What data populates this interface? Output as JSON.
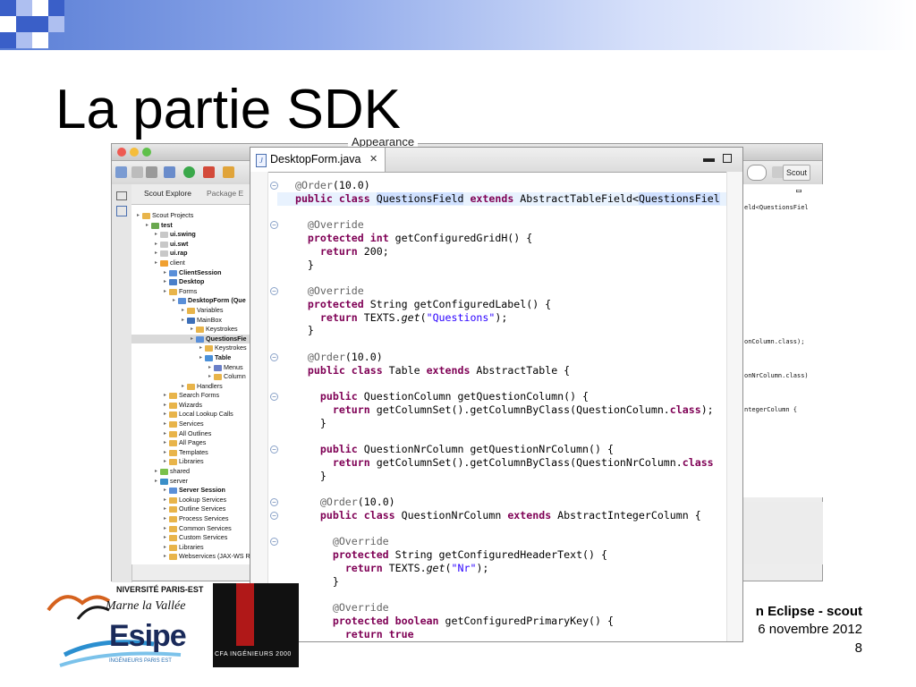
{
  "slide": {
    "title": "La partie SDK",
    "footer_line1": "n Eclipse - scout",
    "footer_line2": "6 novembre 2012",
    "page_number": "8",
    "logo_university": "NIVERSITÉ PARIS-EST",
    "logo_mlv": "Marne la Vallée",
    "logo_esipe": "Esipe",
    "logo_esipe_sub": "INGÉNIEURS PARIS EST",
    "logo_cfa": "CFA INGÉNIEURS 2000"
  },
  "colors": {
    "keyword": "#7f0055",
    "string": "#2a00ff",
    "annotation": "#646464",
    "field": "#0000c0",
    "selection": "#cfe0ff"
  },
  "background_window": {
    "appearance_label": "Appearance",
    "scout_button": "Scout",
    "explorer_tabs": [
      "Scout Explore",
      "Package E"
    ],
    "tree": [
      {
        "label": "Scout Projects",
        "depth": 0,
        "bold": false,
        "icon": "folder"
      },
      {
        "label": "test",
        "depth": 1,
        "bold": true,
        "icon": "project"
      },
      {
        "label": "ui.swing",
        "depth": 2,
        "bold": true,
        "icon": "ui"
      },
      {
        "label": "ui.swt",
        "depth": 2,
        "bold": true,
        "icon": "ui"
      },
      {
        "label": "ui.rap",
        "depth": 2,
        "bold": true,
        "icon": "ui"
      },
      {
        "label": "client",
        "depth": 2,
        "bold": false,
        "icon": "client"
      },
      {
        "label": "ClientSession",
        "depth": 3,
        "bold": true,
        "icon": "session"
      },
      {
        "label": "Desktop",
        "depth": 3,
        "bold": true,
        "icon": "desktop"
      },
      {
        "label": "Forms",
        "depth": 3,
        "bold": false,
        "icon": "folder"
      },
      {
        "label": "DesktopForm (Que",
        "depth": 4,
        "bold": true,
        "icon": "form"
      },
      {
        "label": "Variables",
        "depth": 5,
        "bold": false,
        "icon": "folder"
      },
      {
        "label": "MainBox",
        "depth": 5,
        "bold": false,
        "icon": "box"
      },
      {
        "label": "Keystrokes",
        "depth": 6,
        "bold": false,
        "icon": "folder"
      },
      {
        "label": "QuestionsFie",
        "depth": 6,
        "bold": true,
        "icon": "field",
        "selected": true
      },
      {
        "label": "Keystrokes",
        "depth": 7,
        "bold": false,
        "icon": "folder"
      },
      {
        "label": "Table",
        "depth": 7,
        "bold": true,
        "icon": "table"
      },
      {
        "label": "Menus",
        "depth": 8,
        "bold": false,
        "icon": "menu"
      },
      {
        "label": "Column",
        "depth": 8,
        "bold": false,
        "icon": "folder"
      },
      {
        "label": "Handlers",
        "depth": 5,
        "bold": false,
        "icon": "folder"
      },
      {
        "label": "Search Forms",
        "depth": 3,
        "bold": false,
        "icon": "folder"
      },
      {
        "label": "Wizards",
        "depth": 3,
        "bold": false,
        "icon": "folder"
      },
      {
        "label": "Local Lookup Calls",
        "depth": 3,
        "bold": false,
        "icon": "folder"
      },
      {
        "label": "Services",
        "depth": 3,
        "bold": false,
        "icon": "folder"
      },
      {
        "label": "All Outlines",
        "depth": 3,
        "bold": false,
        "icon": "folder"
      },
      {
        "label": "All Pages",
        "depth": 3,
        "bold": false,
        "icon": "folder"
      },
      {
        "label": "Templates",
        "depth": 3,
        "bold": false,
        "icon": "folder"
      },
      {
        "label": "Libraries",
        "depth": 3,
        "bold": false,
        "icon": "folder"
      },
      {
        "label": "shared",
        "depth": 2,
        "bold": false,
        "icon": "shared"
      },
      {
        "label": "server",
        "depth": 2,
        "bold": false,
        "icon": "server"
      },
      {
        "label": "Server Session",
        "depth": 3,
        "bold": true,
        "icon": "session"
      },
      {
        "label": "Lookup Services",
        "depth": 3,
        "bold": false,
        "icon": "folder"
      },
      {
        "label": "Outline Services",
        "depth": 3,
        "bold": false,
        "icon": "folder"
      },
      {
        "label": "Process Services",
        "depth": 3,
        "bold": false,
        "icon": "folder"
      },
      {
        "label": "Common Services",
        "depth": 3,
        "bold": false,
        "icon": "folder"
      },
      {
        "label": "Custom Services",
        "depth": 3,
        "bold": false,
        "icon": "folder"
      },
      {
        "label": "Libraries",
        "depth": 3,
        "bold": false,
        "icon": "folder"
      },
      {
        "label": "Webservices (JAX-WS R",
        "depth": 3,
        "bold": false,
        "icon": "folder"
      }
    ],
    "right_pane_lines": [
      "eld<QuestionsFiel",
      "onColumn.class);",
      "onNrColumn.class)",
      "ntegerColumn {"
    ]
  },
  "editor": {
    "tab_title": "DesktopForm.java",
    "lines": [
      {
        "indent": 2,
        "parts": [
          [
            "ann",
            "@Order"
          ],
          [
            "",
            "("
          ],
          [
            "",
            "10.0"
          ],
          [
            "",
            ")"
          ]
        ]
      },
      {
        "indent": 2,
        "highlight": true,
        "parts": [
          [
            "kw",
            "public"
          ],
          [
            "",
            " "
          ],
          [
            "kw",
            "class"
          ],
          [
            "",
            " "
          ],
          [
            "sel",
            "QuestionsField"
          ],
          [
            "",
            " "
          ],
          [
            "kw",
            "extends"
          ],
          [
            "",
            " AbstractTableField<"
          ],
          [
            "sel",
            "QuestionsFiel"
          ]
        ]
      },
      {
        "indent": 0,
        "parts": []
      },
      {
        "indent": 4,
        "parts": [
          [
            "ann",
            "@Override"
          ]
        ]
      },
      {
        "indent": 4,
        "parts": [
          [
            "kw",
            "protected"
          ],
          [
            "",
            " "
          ],
          [
            "kw",
            "int"
          ],
          [
            "",
            " getConfiguredGridH() {"
          ]
        ]
      },
      {
        "indent": 6,
        "parts": [
          [
            "kw",
            "return"
          ],
          [
            "",
            " 200;"
          ]
        ]
      },
      {
        "indent": 4,
        "parts": [
          [
            "",
            "}"
          ]
        ]
      },
      {
        "indent": 0,
        "parts": []
      },
      {
        "indent": 4,
        "parts": [
          [
            "ann",
            "@Override"
          ]
        ]
      },
      {
        "indent": 4,
        "parts": [
          [
            "kw",
            "protected"
          ],
          [
            "",
            " String getConfiguredLabel() {"
          ]
        ]
      },
      {
        "indent": 6,
        "parts": [
          [
            "kw",
            "return"
          ],
          [
            "",
            " TEXTS."
          ],
          [
            "it",
            "get"
          ],
          [
            "",
            "("
          ],
          [
            "str",
            "\"Questions\""
          ],
          [
            "",
            ");"
          ]
        ]
      },
      {
        "indent": 4,
        "parts": [
          [
            "",
            "}"
          ]
        ]
      },
      {
        "indent": 0,
        "parts": []
      },
      {
        "indent": 4,
        "parts": [
          [
            "ann",
            "@Order"
          ],
          [
            "",
            "(10.0)"
          ]
        ]
      },
      {
        "indent": 4,
        "parts": [
          [
            "kw",
            "public"
          ],
          [
            "",
            " "
          ],
          [
            "kw",
            "class"
          ],
          [
            "",
            " Table "
          ],
          [
            "kw",
            "extends"
          ],
          [
            "",
            " AbstractTable {"
          ]
        ]
      },
      {
        "indent": 0,
        "parts": []
      },
      {
        "indent": 6,
        "parts": [
          [
            "kw",
            "public"
          ],
          [
            "",
            " QuestionColumn getQuestionColumn() {"
          ]
        ]
      },
      {
        "indent": 8,
        "parts": [
          [
            "kw",
            "return"
          ],
          [
            "",
            " getColumnSet().getColumnByClass(QuestionColumn."
          ],
          [
            "kw",
            "class"
          ],
          [
            "",
            ");"
          ]
        ]
      },
      {
        "indent": 6,
        "parts": [
          [
            "",
            "}"
          ]
        ]
      },
      {
        "indent": 0,
        "parts": []
      },
      {
        "indent": 6,
        "parts": [
          [
            "kw",
            "public"
          ],
          [
            "",
            " QuestionNrColumn getQuestionNrColumn() {"
          ]
        ]
      },
      {
        "indent": 8,
        "parts": [
          [
            "kw",
            "return"
          ],
          [
            "",
            " getColumnSet().getColumnByClass(QuestionNrColumn."
          ],
          [
            "kw",
            "class"
          ],
          [
            ")"
          ]
        ]
      },
      {
        "indent": 6,
        "parts": [
          [
            "",
            "}"
          ]
        ]
      },
      {
        "indent": 0,
        "parts": []
      },
      {
        "indent": 6,
        "parts": [
          [
            "ann",
            "@Order"
          ],
          [
            "",
            "(10.0)"
          ]
        ]
      },
      {
        "indent": 6,
        "parts": [
          [
            "kw",
            "public"
          ],
          [
            "",
            " "
          ],
          [
            "kw",
            "class"
          ],
          [
            "",
            " QuestionNrColumn "
          ],
          [
            "kw",
            "extends"
          ],
          [
            "",
            " AbstractIntegerColumn {"
          ]
        ]
      },
      {
        "indent": 0,
        "parts": []
      },
      {
        "indent": 8,
        "parts": [
          [
            "ann",
            "@Override"
          ]
        ]
      },
      {
        "indent": 8,
        "parts": [
          [
            "kw",
            "protected"
          ],
          [
            "",
            " String getConfiguredHeaderText() {"
          ]
        ]
      },
      {
        "indent": 10,
        "parts": [
          [
            "kw",
            "return"
          ],
          [
            "",
            " TEXTS."
          ],
          [
            "it",
            "get"
          ],
          [
            "",
            "("
          ],
          [
            "str",
            "\"Nr\""
          ],
          [
            "",
            ");"
          ]
        ]
      },
      {
        "indent": 8,
        "parts": [
          [
            "",
            "}"
          ]
        ]
      },
      {
        "indent": 0,
        "parts": []
      },
      {
        "indent": 8,
        "parts": [
          [
            "ann",
            "@Override"
          ]
        ]
      },
      {
        "indent": 8,
        "parts": [
          [
            "kw",
            "protected"
          ],
          [
            "",
            " "
          ],
          [
            "kw",
            "boolean"
          ],
          [
            "",
            " getConfiguredPrimaryKey() {"
          ]
        ]
      },
      {
        "indent": 10,
        "parts": [
          [
            "kw",
            "return"
          ],
          [
            "",
            " "
          ],
          [
            "kw",
            "true"
          ],
          [
            ";"
          ]
        ]
      },
      {
        "indent": 8,
        "parts": [
          [
            "",
            "}"
          ]
        ]
      }
    ]
  }
}
